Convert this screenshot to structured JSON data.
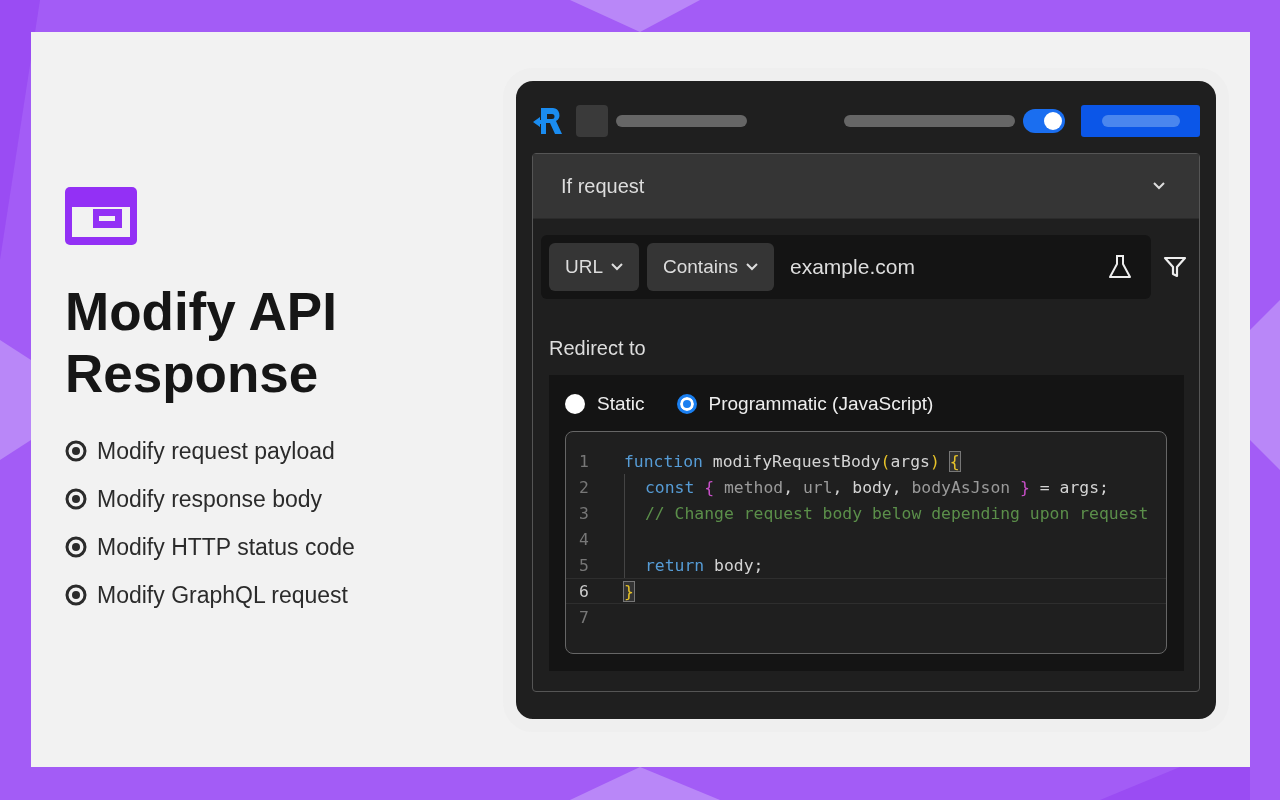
{
  "promo": {
    "title": "Modify API Response",
    "features": [
      {
        "label": "Modify request payload"
      },
      {
        "label": "Modify response body"
      },
      {
        "label": "Modify HTTP status code"
      },
      {
        "label": "Modify GraphQL request"
      }
    ]
  },
  "app": {
    "header": {
      "toggle_on": true
    },
    "rule": {
      "section_title": "If request",
      "condition": {
        "field": "URL",
        "operator": "Contains",
        "value": "example.com"
      },
      "redirect_label": "Redirect to",
      "options": [
        {
          "label": "Static",
          "selected": false
        },
        {
          "label": "Programmatic (JavaScript)",
          "selected": true
        }
      ],
      "editor": {
        "lines": [
          {
            "number": "1",
            "current": false,
            "indented": false,
            "tokens": [
              {
                "kind": "keyword",
                "text": "function"
              },
              {
                "kind": "plain",
                "text": " modifyRequestBody"
              },
              {
                "kind": "paren",
                "text": "("
              },
              {
                "kind": "plain",
                "text": "args"
              },
              {
                "kind": "paren",
                "text": ") "
              },
              {
                "kind": "brace-match",
                "text": "{"
              }
            ]
          },
          {
            "number": "2",
            "current": false,
            "indented": true,
            "tokens": [
              {
                "kind": "keyword",
                "text": "const "
              },
              {
                "kind": "brace",
                "text": "{"
              },
              {
                "kind": "dim",
                "text": " method"
              },
              {
                "kind": "plain",
                "text": ", "
              },
              {
                "kind": "dim",
                "text": "url"
              },
              {
                "kind": "plain",
                "text": ", body, "
              },
              {
                "kind": "dim",
                "text": "bodyAsJson "
              },
              {
                "kind": "brace",
                "text": "}"
              },
              {
                "kind": "plain",
                "text": " = args;"
              }
            ]
          },
          {
            "number": "3",
            "current": false,
            "indented": true,
            "tokens": [
              {
                "kind": "comment",
                "text": "// Change request body below depending upon request"
              }
            ]
          },
          {
            "number": "4",
            "current": false,
            "indented": true
          },
          {
            "number": "5",
            "current": false,
            "indented": true,
            "tokens": [
              {
                "kind": "keyword",
                "text": "return"
              },
              {
                "kind": "plain",
                "text": " body;"
              }
            ]
          },
          {
            "number": "6",
            "current": true,
            "indented": false,
            "tokens": [
              {
                "kind": "brace-match",
                "text": "}"
              }
            ]
          },
          {
            "number": "7",
            "current": false,
            "indented": false
          }
        ]
      }
    }
  }
}
